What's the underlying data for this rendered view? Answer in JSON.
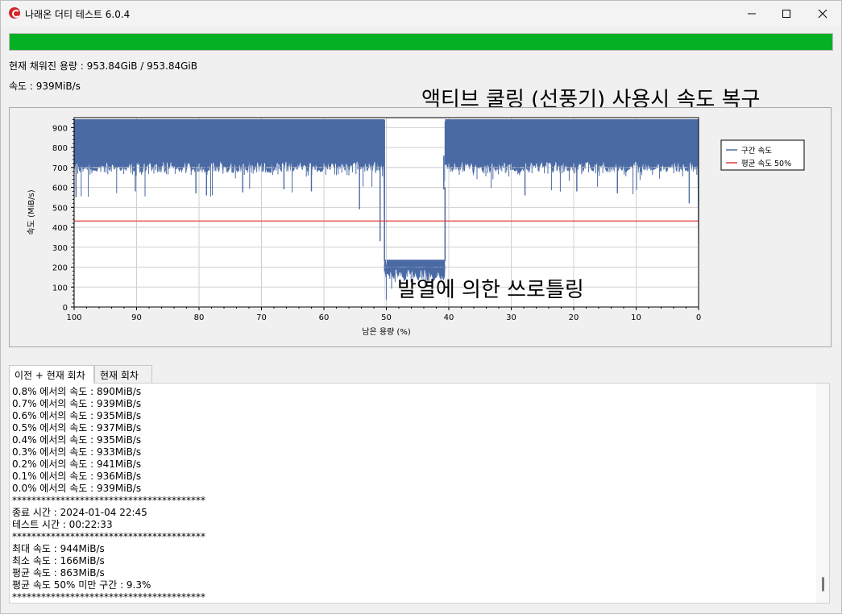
{
  "window": {
    "title": "나래온 더티 테스트 6.0.4"
  },
  "progress": {
    "value": 1.0,
    "color": "#06b025"
  },
  "info": {
    "capacity": "현재 채워진 용량 : 953.84GiB / 953.84GiB",
    "speed": "속도 : 939MiB/s"
  },
  "annotations": {
    "top": "액티브 쿨링 (선풍기) 사용시 속도 복구",
    "middle": "발열에 의한 쓰로틀링"
  },
  "chart_data": {
    "type": "area",
    "xlabel": "남은 용량 (%)",
    "ylabel": "속도 (MiB/s)",
    "xlim": [
      100,
      0
    ],
    "ylim": [
      0,
      950
    ],
    "x_ticks": [
      "100",
      "90",
      "80",
      "70",
      "60",
      "50",
      "40",
      "30",
      "20",
      "10",
      "0"
    ],
    "y_ticks": [
      "0",
      "100",
      "200",
      "300",
      "400",
      "500",
      "600",
      "700",
      "800",
      "900"
    ],
    "grid": true,
    "legend_position": "right",
    "series": [
      {
        "name": "구간 속도",
        "color": "#4a6aa5",
        "segments": [
          {
            "x_from": 100,
            "x_to": 50.3,
            "level": 940,
            "floor": 730,
            "note_min": 480
          },
          {
            "x_from": 50.3,
            "x_to": 40.6,
            "level": 235,
            "floor": 190,
            "note_min": 166
          },
          {
            "x_from": 40.6,
            "x_to": 0,
            "level": 940,
            "floor": 730,
            "note_min": 490
          }
        ],
        "dips": [
          {
            "x": 99.7,
            "y": 550
          },
          {
            "x": 90.2,
            "y": 580
          },
          {
            "x": 80.5,
            "y": 570
          },
          {
            "x": 78.8,
            "y": 560
          },
          {
            "x": 73.0,
            "y": 575
          },
          {
            "x": 66.4,
            "y": 590
          },
          {
            "x": 62.0,
            "y": 580
          },
          {
            "x": 54.3,
            "y": 490
          },
          {
            "x": 51.0,
            "y": 330
          },
          {
            "x": 40.8,
            "y": 590
          },
          {
            "x": 27.8,
            "y": 560
          },
          {
            "x": 19.5,
            "y": 580
          },
          {
            "x": 13.0,
            "y": 570
          },
          {
            "x": 1.5,
            "y": 520
          }
        ]
      },
      {
        "name": "평균 속도 50%",
        "color": "#e03c3c",
        "values": [
          431.5,
          431.5
        ]
      }
    ]
  },
  "tabs": [
    {
      "label": "이전 + 현재 회차",
      "active": true
    },
    {
      "label": "현재 회차",
      "active": false
    }
  ],
  "log": {
    "lines": [
      "0.8% 에서의 속도 : 890MiB/s",
      "0.7% 에서의 속도 : 939MiB/s",
      "0.6% 에서의 속도 : 935MiB/s",
      "0.5% 에서의 속도 : 937MiB/s",
      "0.4% 에서의 속도 : 935MiB/s",
      "0.3% 에서의 속도 : 933MiB/s",
      "0.2% 에서의 속도 : 941MiB/s",
      "0.1% 에서의 속도 : 936MiB/s",
      "0.0% 에서의 속도 : 939MiB/s",
      "****************************************",
      "종료 시간 : 2024-01-04 22:45",
      "테스트 시간 : 00:22:33",
      "****************************************",
      "최대 속도 : 944MiB/s",
      "최소 속도 : 166MiB/s",
      "평균 속도 : 863MiB/s",
      "평균 속도 50% 미만 구간 : 9.3%",
      "****************************************"
    ]
  }
}
